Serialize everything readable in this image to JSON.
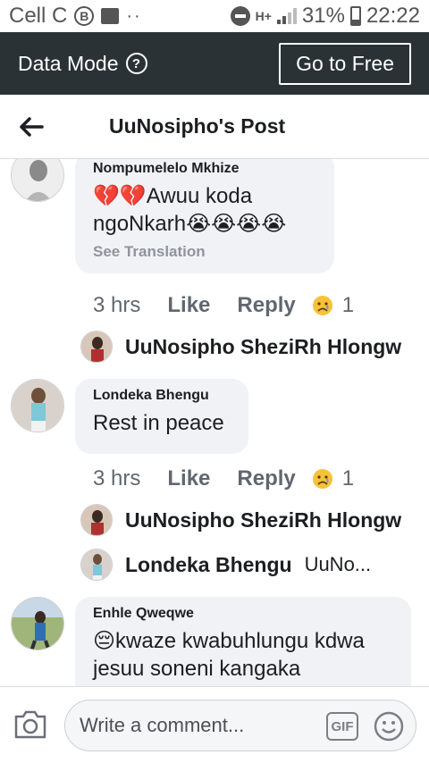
{
  "status_bar": {
    "carrier": "Cell C",
    "carrier_badge": "B",
    "dots": "··",
    "network": "H+",
    "battery": "31%",
    "time": "22:22"
  },
  "data_bar": {
    "label": "Data Mode",
    "help_glyph": "?",
    "button_label": "Go to Free"
  },
  "header": {
    "title": "UuNosipho's Post"
  },
  "comments": [
    {
      "author": "Nompumelelo Mkhize",
      "text_line1": "💔💔Awuu koda",
      "text_line2": "ngoNkarh😭😭😭😭",
      "see_translation": "See Translation",
      "time": "3 hrs",
      "like": "Like",
      "reply": "Reply",
      "reaction_count": "1",
      "replies": [
        {
          "name": "UuNosipho SheziRh Hlongw"
        }
      ]
    },
    {
      "author": "Londeka Bhengu",
      "text": "Rest in peace",
      "time": "3 hrs",
      "like": "Like",
      "reply": "Reply",
      "reaction_count": "1",
      "replies": [
        {
          "name": "UuNosipho SheziRh Hlongw"
        },
        {
          "name": "Londeka Bhengu",
          "preview": "UuNo..."
        }
      ]
    },
    {
      "author": "Enhle Qweqwe",
      "text_line1": "😔kwaze kwabuhlungu kdwa",
      "text_line2": "jesuu soneni kangaka"
    }
  ],
  "composer": {
    "placeholder": "Write a comment...",
    "gif_label": "GIF"
  },
  "colors": {
    "data_bar_bg": "#2b3236",
    "bubble_bg": "#f0f2f5",
    "muted_text": "#606770"
  },
  "icons": [
    "back-arrow-icon",
    "help-icon",
    "camera-icon",
    "gif-icon",
    "smiley-icon",
    "sad-reaction-icon"
  ]
}
